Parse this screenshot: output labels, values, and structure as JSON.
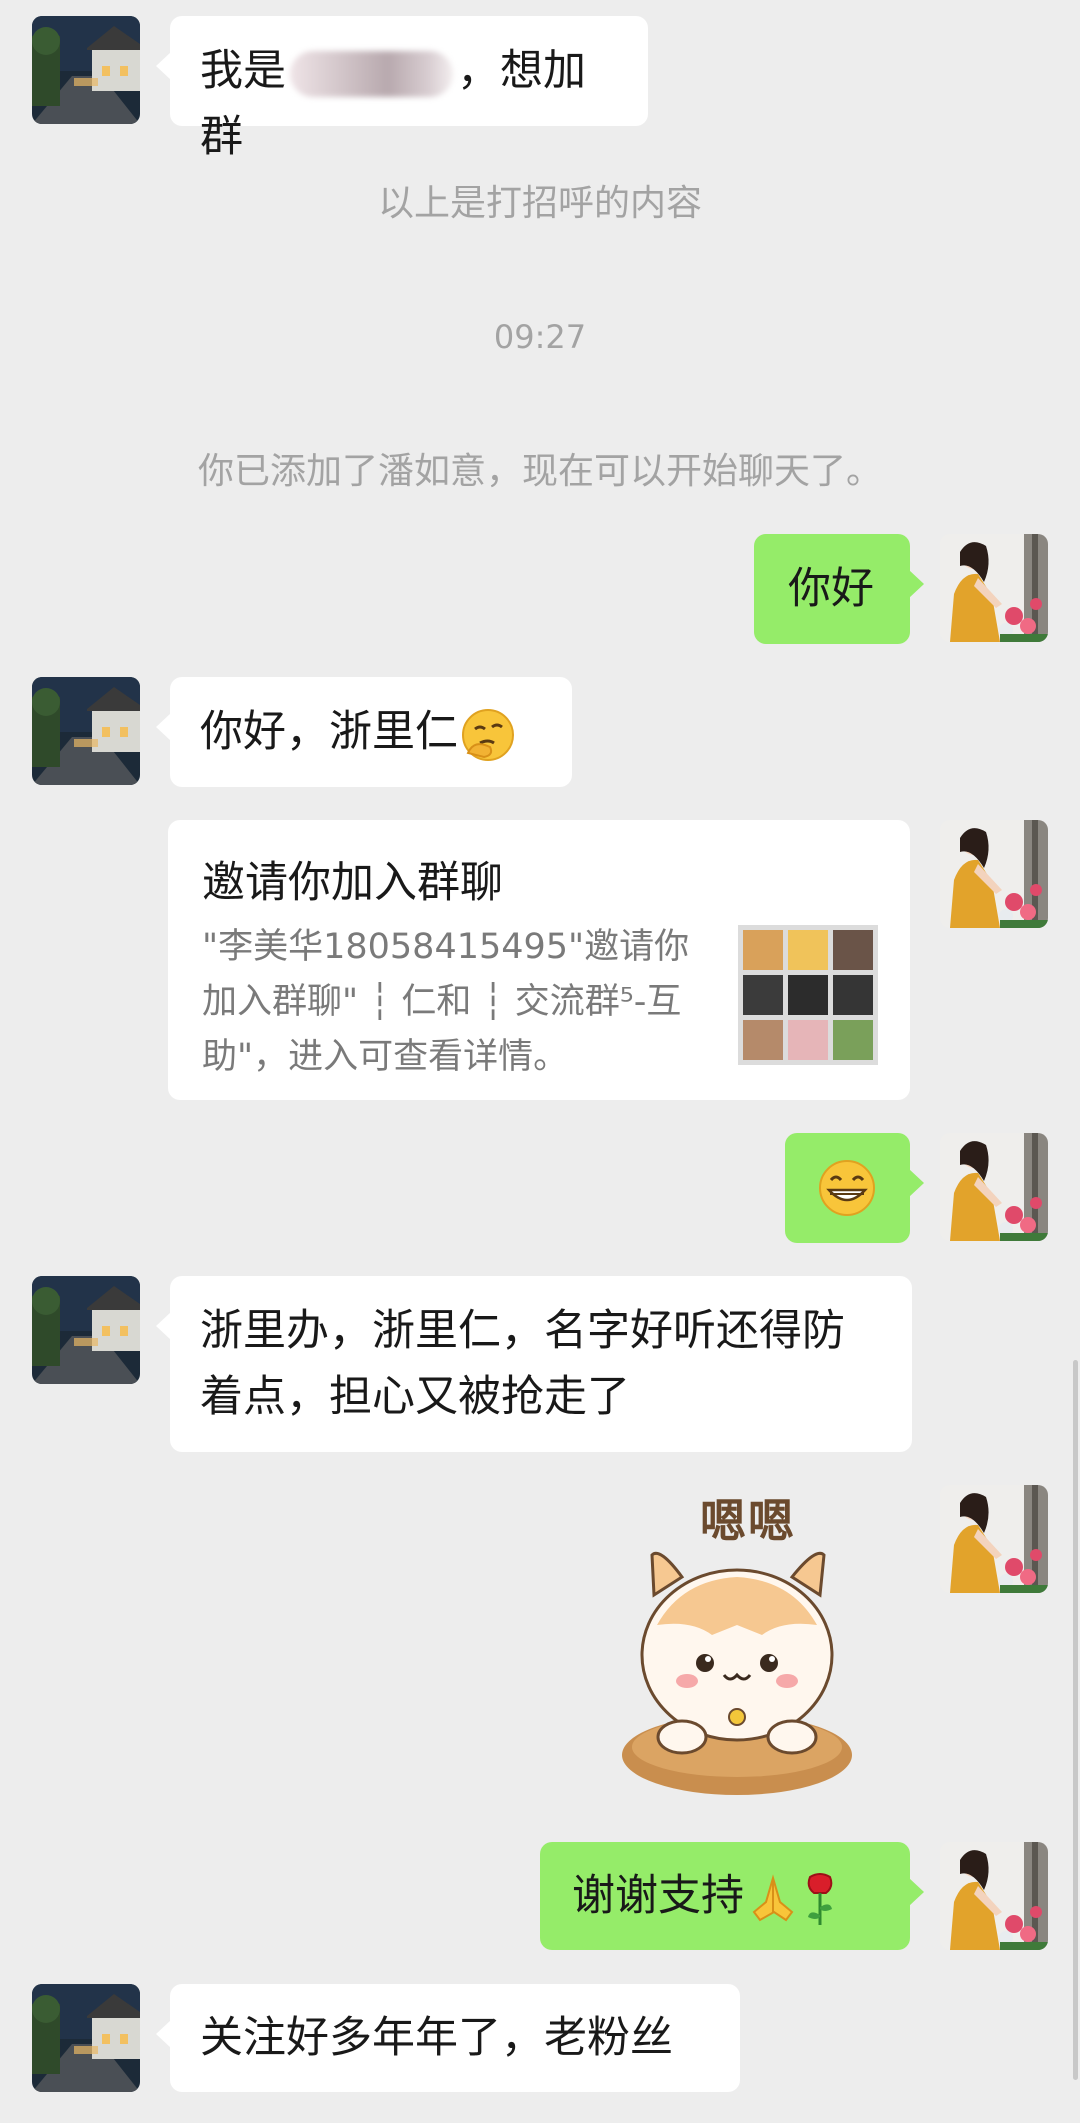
{
  "messages": {
    "m1_prefix": "我是",
    "m1_suffix": "，想加群",
    "greeting_note": "以上是打招呼的内容",
    "time": "09:27",
    "added_notice": "你已添加了潘如意，现在可以开始聊天了。",
    "m2": "你好",
    "m3": "你好，浙里仁",
    "invite_title": "邀请你加入群聊",
    "invite_desc": "\"李美华18058415495\"邀请你加入群聊\" ┆ 仁和 ┆ 交流群⁵-互助\"，进入可查看详情。",
    "m6": "浙里办，浙里仁，名字好听还得防着点，担心又被抢走了",
    "sticker_text": "嗯嗯",
    "m8": "谢谢支持",
    "m9": "关注好多年年了，老粉丝"
  },
  "colors": {
    "background": "#ededed",
    "bubble_self": "#95ec69",
    "bubble_other": "#ffffff",
    "system_text": "#a3a3a3"
  },
  "icons": {
    "emoji_m3": "thinking-face-emoji",
    "emoji_m5": "grinning-face-emoji",
    "emoji_m8": [
      "pray-hands-emoji",
      "rose-emoji"
    ]
  }
}
